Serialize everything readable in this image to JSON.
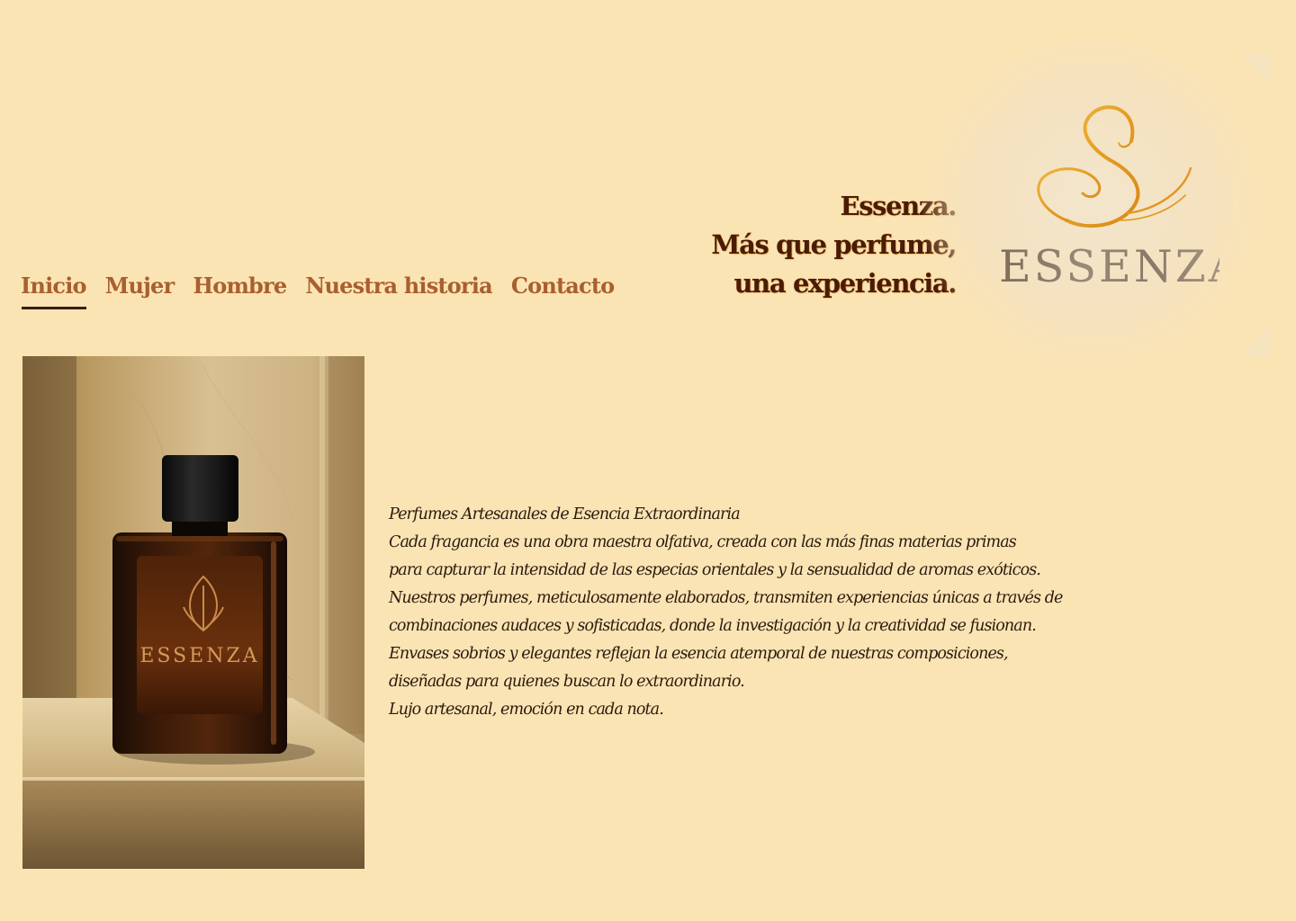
{
  "nav": {
    "items": [
      {
        "label": "Inicio",
        "active": true
      },
      {
        "label": "Mujer",
        "active": false
      },
      {
        "label": "Hombre",
        "active": false
      },
      {
        "label": "Nuestra historia",
        "active": false
      },
      {
        "label": "Contacto",
        "active": false
      }
    ]
  },
  "hero": {
    "tagline_lines": [
      "Essenza.",
      "Más que perfume,",
      "una experiencia."
    ]
  },
  "logo": {
    "wordmark": "ESSENZA",
    "icon": "swirl-s-icon"
  },
  "product": {
    "image": "perfume-bottle-photo",
    "bottle_label": "ESSENZA"
  },
  "description": {
    "lines": [
      "Perfumes Artesanales de Esencia Extraordinaria",
      "Cada fragancia es una obra maestra olfativa, creada con las más finas  materias primas",
      "para capturar la intensidad de las especias orientales y la sensualidad de aromas exóticos.",
      "Nuestros perfumes, meticulosamente  elaborados, transmiten experiencias únicas a través de",
      "combinaciones  audaces y sofisticadas, donde la investigación y la creatividad se  fusionan.",
      "Envases sobrios y elegantes reflejan la esencia atemporal de  nuestras composiciones,",
      "diseñadas para quienes buscan lo extraordinario.",
      "Lujo artesanal, emoción en cada nota."
    ]
  },
  "colors": {
    "background": "#fbe4b4",
    "nav_text": "#a95f2e",
    "tagline": "#4a1c06",
    "logo_gold": "#e0a030",
    "body_text": "#2a1a0e"
  }
}
